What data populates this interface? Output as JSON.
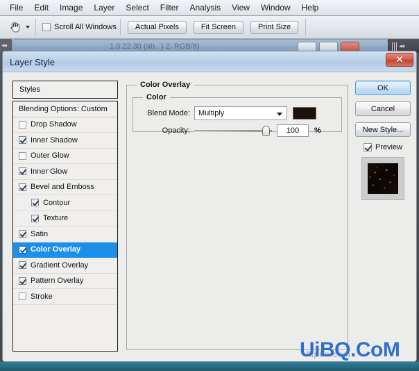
{
  "menubar": {
    "items": [
      {
        "label": "File"
      },
      {
        "label": "Edit"
      },
      {
        "label": "Image"
      },
      {
        "label": "Layer"
      },
      {
        "label": "Select"
      },
      {
        "label": "Filter"
      },
      {
        "label": "Analysis"
      },
      {
        "label": "View"
      },
      {
        "label": "Window"
      },
      {
        "label": "Help"
      }
    ]
  },
  "toolbar": {
    "active_tool": "hand-tool",
    "scroll_all_windows": {
      "label": "Scroll All Windows",
      "checked": false
    },
    "buttons": [
      {
        "label": "Actual Pixels"
      },
      {
        "label": "Fit Screen"
      },
      {
        "label": "Print Size"
      }
    ]
  },
  "document_window": {
    "title": "1.0.22.30 (ab...) 2, RGB/8)"
  },
  "dialog": {
    "title": "Layer Style",
    "close_label": "✕",
    "styles_panel": {
      "header": "Styles",
      "blending_options": "Blending Options: Custom",
      "effects": [
        {
          "label": "Drop Shadow",
          "checked": false,
          "sub": false,
          "selected": false
        },
        {
          "label": "Inner Shadow",
          "checked": true,
          "sub": false,
          "selected": false
        },
        {
          "label": "Outer Glow",
          "checked": false,
          "sub": false,
          "selected": false
        },
        {
          "label": "Inner Glow",
          "checked": true,
          "sub": false,
          "selected": false
        },
        {
          "label": "Bevel and Emboss",
          "checked": true,
          "sub": false,
          "selected": false
        },
        {
          "label": "Contour",
          "checked": true,
          "sub": true,
          "selected": false
        },
        {
          "label": "Texture",
          "checked": true,
          "sub": true,
          "selected": false
        },
        {
          "label": "Satin",
          "checked": true,
          "sub": false,
          "selected": false
        },
        {
          "label": "Color Overlay",
          "checked": true,
          "sub": false,
          "selected": true
        },
        {
          "label": "Gradient Overlay",
          "checked": true,
          "sub": false,
          "selected": false
        },
        {
          "label": "Pattern Overlay",
          "checked": true,
          "sub": false,
          "selected": false
        },
        {
          "label": "Stroke",
          "checked": false,
          "sub": false,
          "selected": false
        }
      ]
    },
    "settings_panel": {
      "group_title": "Color Overlay",
      "subgroup_title": "Color",
      "blend_mode": {
        "label": "Blend Mode:",
        "value": "Multiply",
        "swatch_color": "#1c1108"
      },
      "opacity": {
        "label": "Opacity:",
        "value": "100",
        "unit": "%",
        "min": 0,
        "max": 100
      }
    },
    "actions": {
      "ok": "OK",
      "cancel": "Cancel",
      "new_style": "New Style...",
      "preview": {
        "label": "Preview",
        "checked": true
      }
    }
  },
  "watermark": {
    "text": "UiBQ.CoM",
    "faint_text": "Alpha.com",
    "color": "#2f6fd0"
  }
}
